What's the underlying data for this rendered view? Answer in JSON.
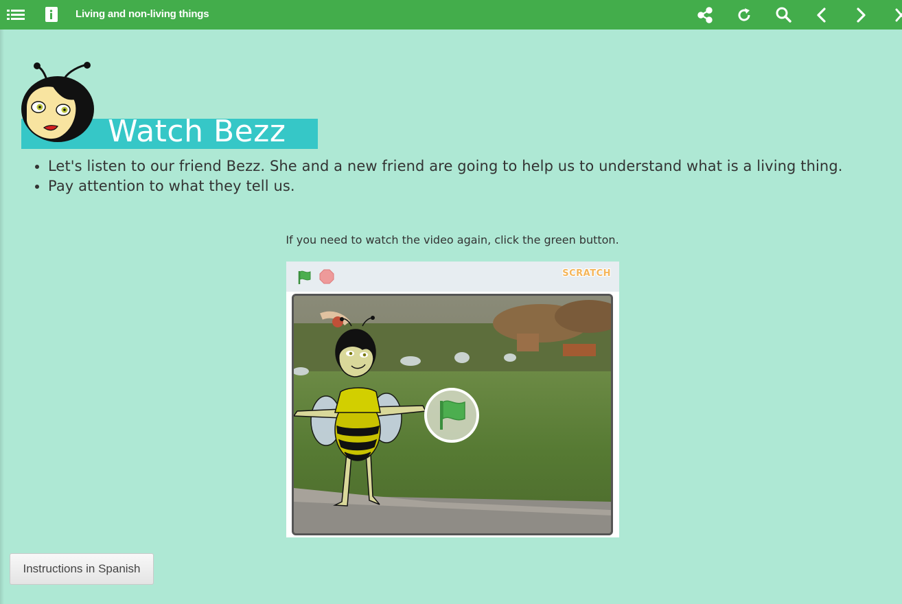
{
  "topbar": {
    "title": "Living and non-living things",
    "icons": [
      "list-icon",
      "book-icon",
      "share-icon",
      "reload-icon",
      "search-icon",
      "chevron-left-icon",
      "chevron-right-icon",
      "close-icon"
    ],
    "color": "#43ad4b"
  },
  "page": {
    "heading": "Watch Bezz",
    "bullets": [
      "Let's listen to our friend Bezz. She and a new friend are going to help us to understand what is a living thing.",
      "Pay attention to what they tell us."
    ],
    "hint": "If you need to watch the video again, click the green button."
  },
  "player": {
    "logo_text": "SCRATCH",
    "controls": [
      "green-flag-icon",
      "stop-icon"
    ]
  },
  "footer": {
    "spanish_button": "Instructions in Spanish"
  },
  "colors": {
    "background": "#aee8d4",
    "heading_bar": "#36c7c7",
    "flag_green": "#4cae4f"
  }
}
